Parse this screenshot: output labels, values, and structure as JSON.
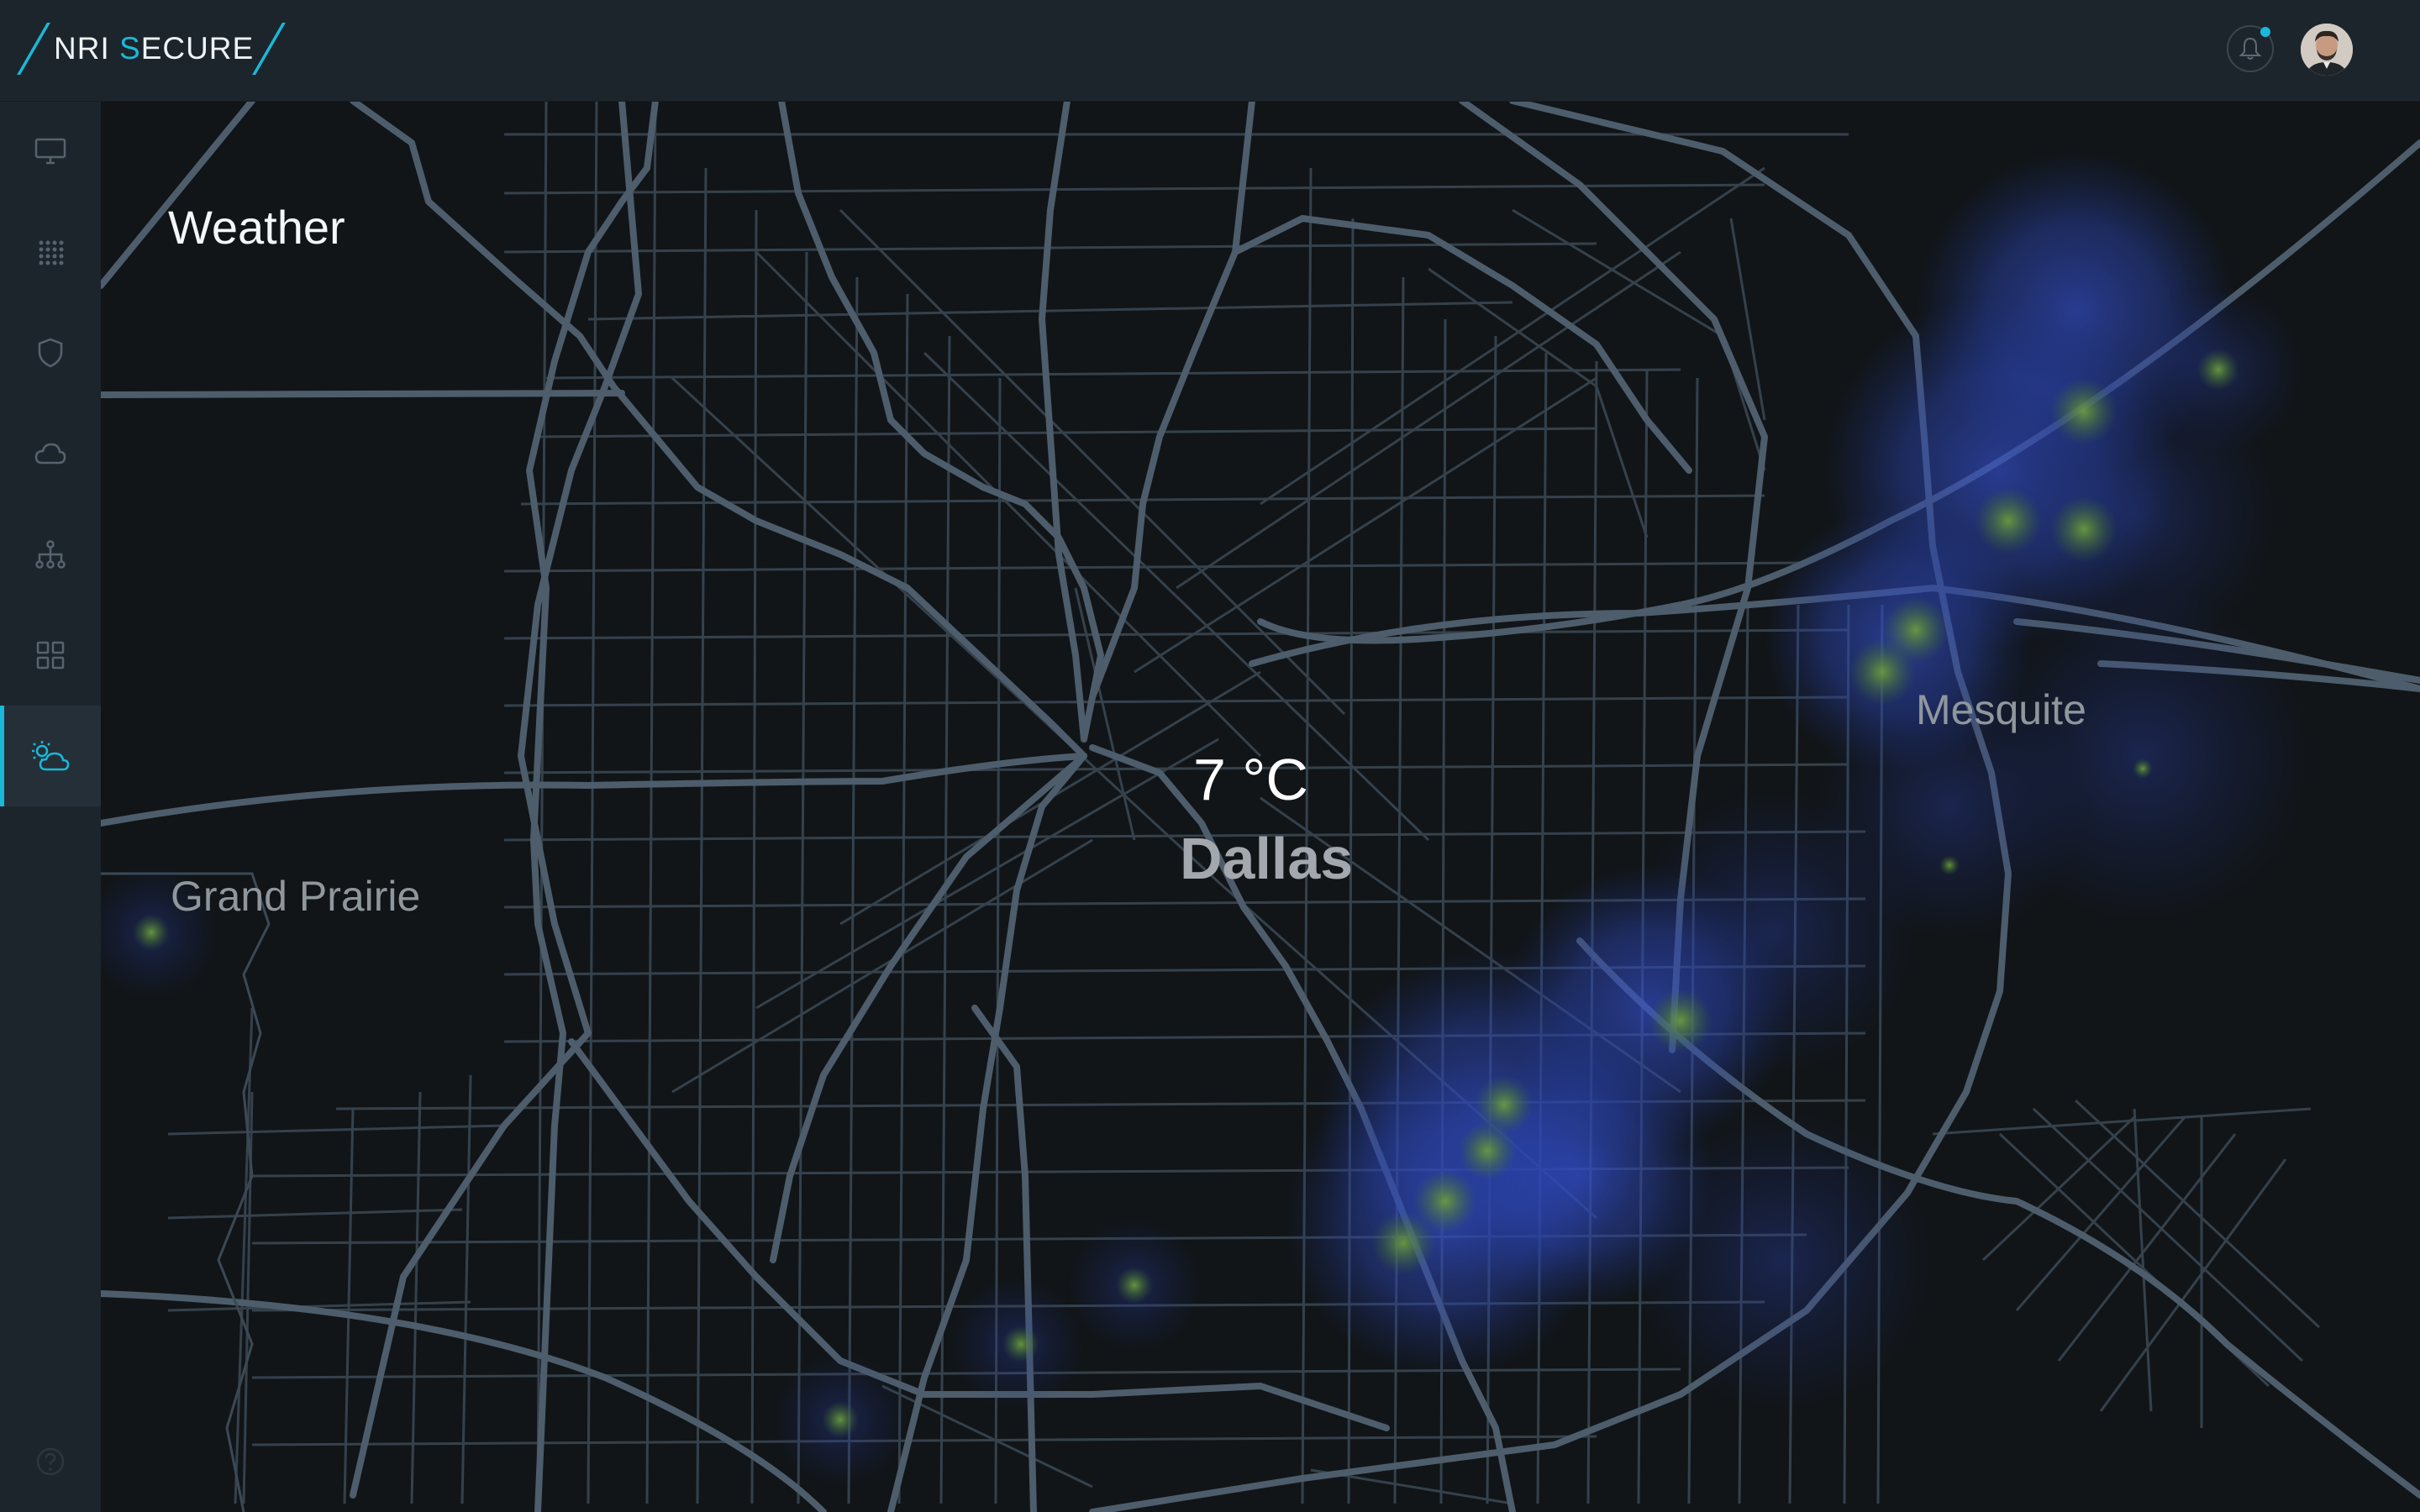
{
  "header": {
    "logo": {
      "part1": "NRI ",
      "accent": "S",
      "part2": "ECURE"
    },
    "notification_icon": "bell-icon",
    "avatar_icon": "user-avatar"
  },
  "sidebar": {
    "items": [
      {
        "icon": "monitor-icon",
        "active": false
      },
      {
        "icon": "grid-dots-icon",
        "active": false
      },
      {
        "icon": "shield-icon",
        "active": false
      },
      {
        "icon": "cloud-icon",
        "active": false
      },
      {
        "icon": "network-icon",
        "active": false
      },
      {
        "icon": "dashboard-icon",
        "active": false
      },
      {
        "icon": "weather-icon",
        "active": true
      }
    ],
    "help_icon": "help-icon"
  },
  "page": {
    "title": "Weather"
  },
  "map": {
    "current": {
      "temperature": "7 °C",
      "city": "Dallas"
    },
    "labels": [
      "Grand Prairie",
      "Mesquite"
    ],
    "zoom": {
      "in": "+",
      "out": "−"
    }
  },
  "colors": {
    "accent": "#1ab8d8",
    "header_bg": "#1d252c",
    "map_bg": "#111518",
    "roads": "#4a5a68",
    "precip_blue": "#2d46b4",
    "precip_green": "#5a8c32"
  }
}
